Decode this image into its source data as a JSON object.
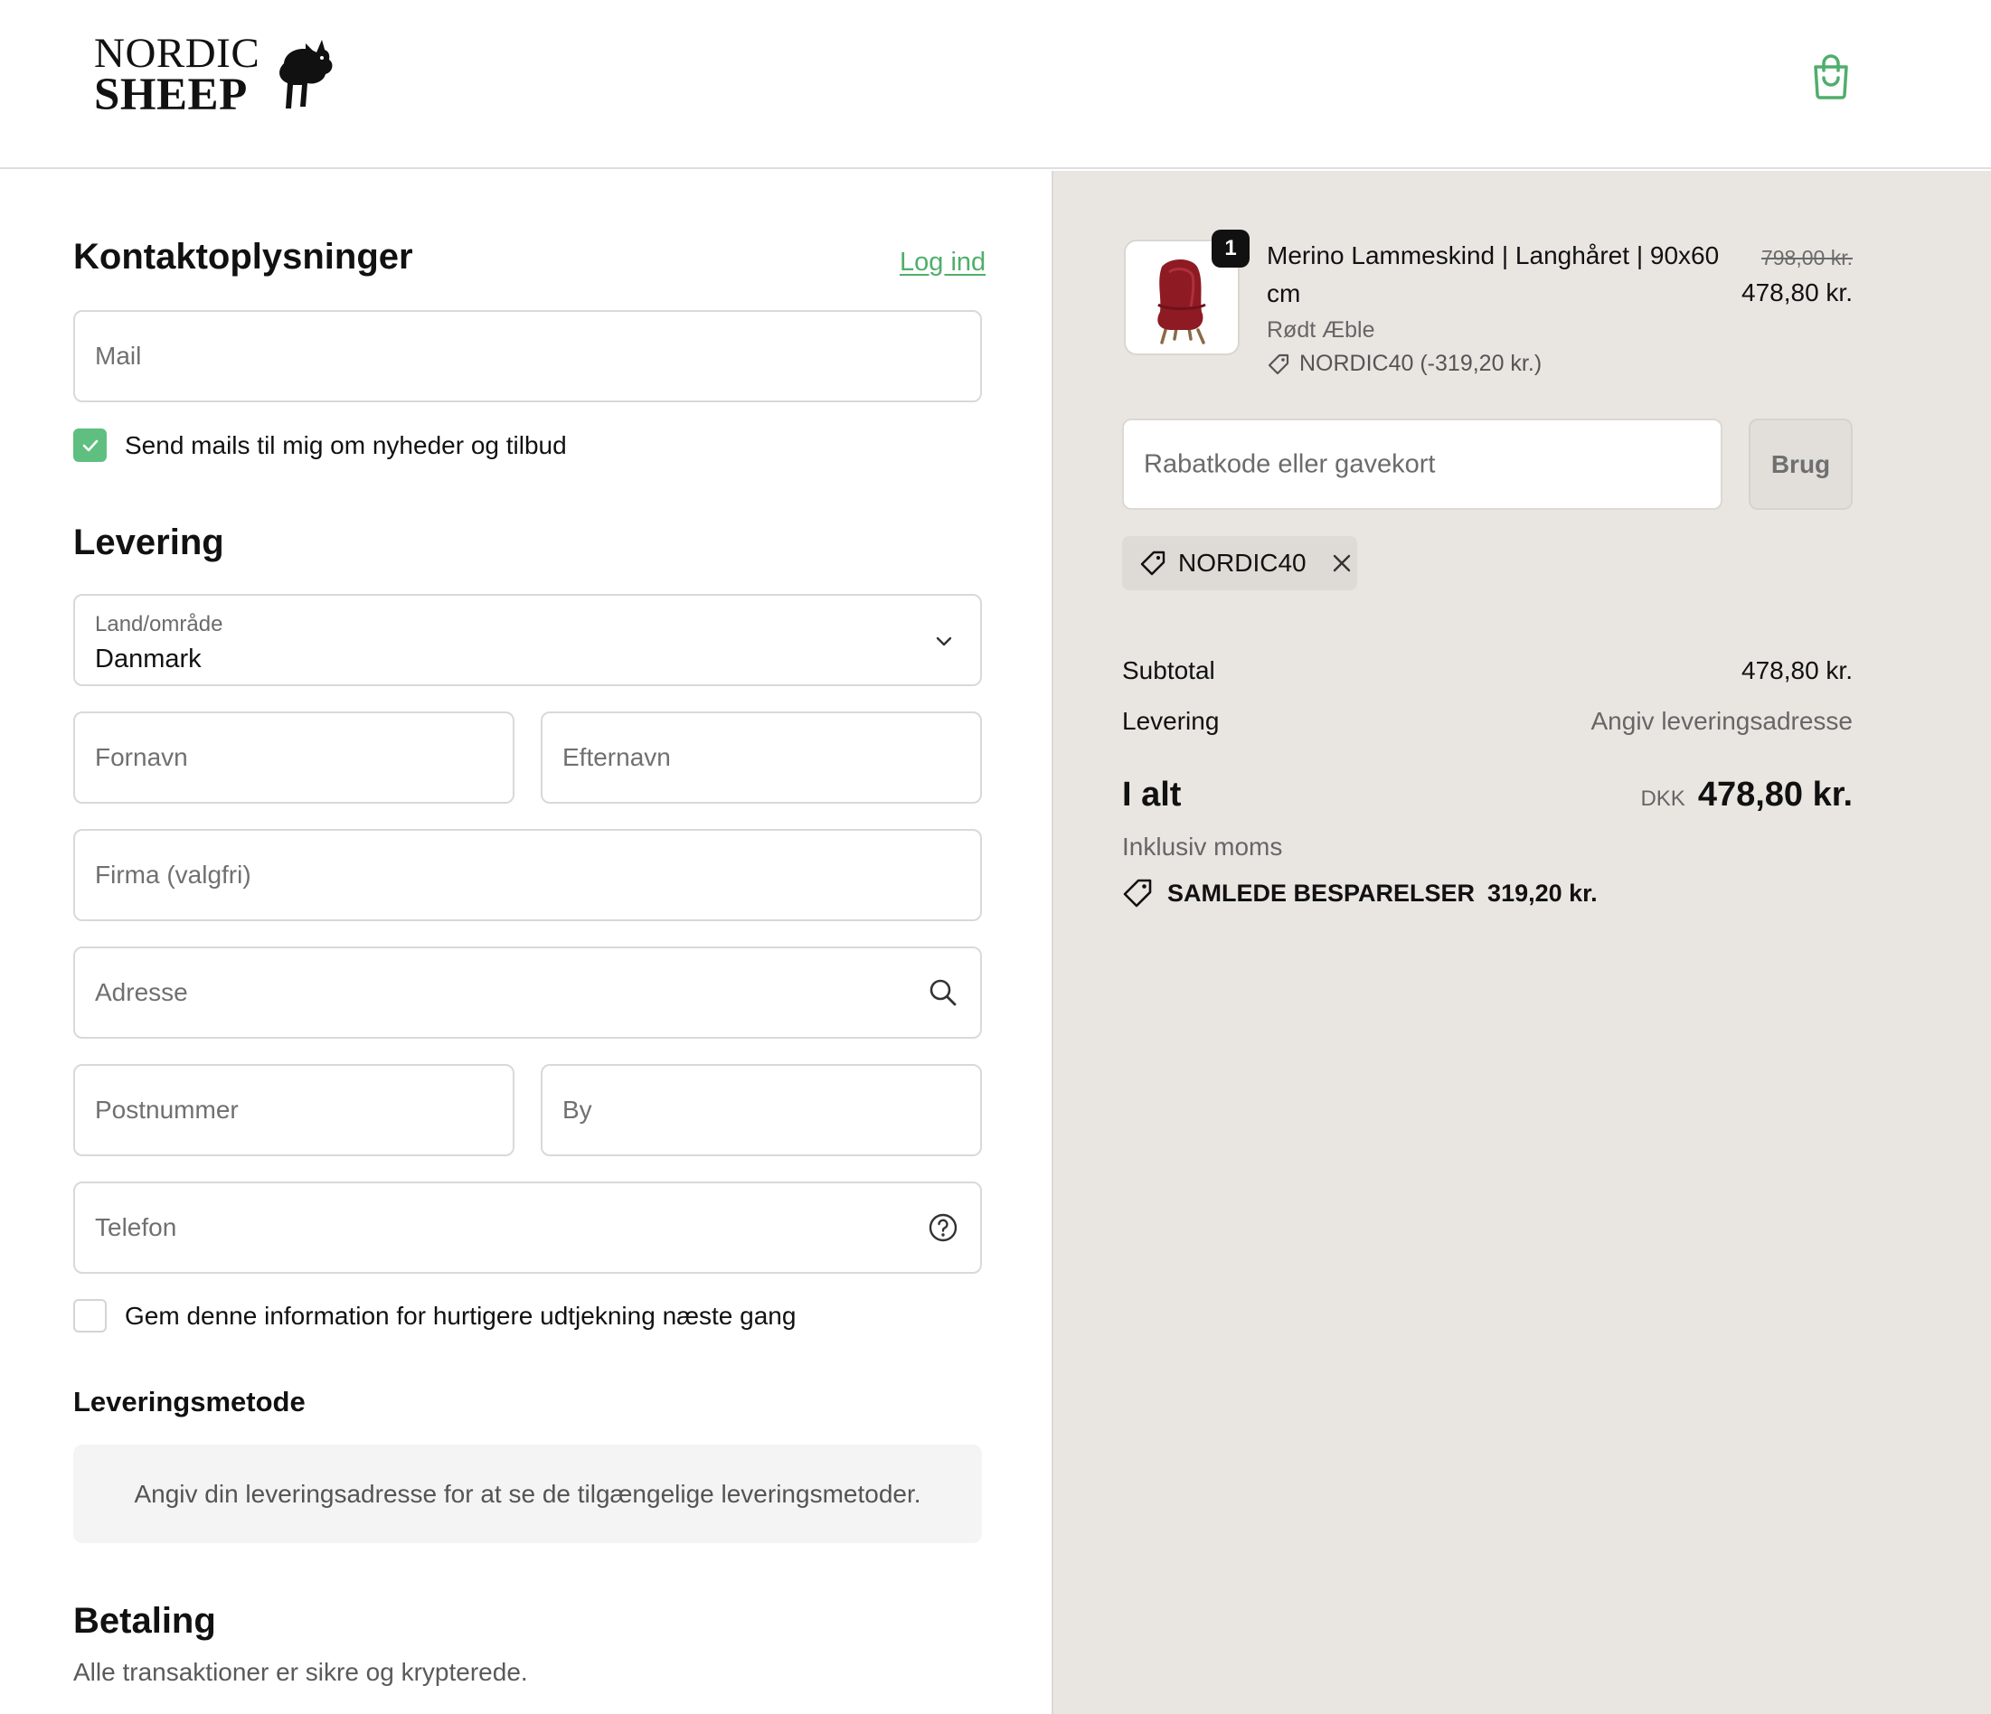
{
  "brand": {
    "line1": "NORDIC",
    "line2": "SHEEP"
  },
  "contact": {
    "title": "Kontaktoplysninger",
    "login_link": "Log ind",
    "email_placeholder": "Mail",
    "newsletter_label": "Send mails til mig om nyheder og tilbud",
    "newsletter_checked": true
  },
  "delivery": {
    "title": "Levering",
    "country_label": "Land/område",
    "country_value": "Danmark",
    "first_name_placeholder": "Fornavn",
    "last_name_placeholder": "Efternavn",
    "company_placeholder": "Firma (valgfri)",
    "address_placeholder": "Adresse",
    "postal_placeholder": "Postnummer",
    "city_placeholder": "By",
    "phone_placeholder": "Telefon",
    "save_info_label": "Gem denne information for hurtigere udtjekning næste gang",
    "save_info_checked": false
  },
  "shipping_method": {
    "title": "Leveringsmetode",
    "info": "Angiv din leveringsadresse for at se de tilgængelige leveringsmetoder."
  },
  "payment": {
    "title": "Betaling",
    "subtitle": "Alle transaktioner er sikre og krypterede."
  },
  "summary": {
    "item": {
      "quantity": "1",
      "title": "Merino Lammeskind | Langhåret | 90x60 cm",
      "variant": "Rødt Æble",
      "discount": "NORDIC40 (-319,20 kr.)",
      "old_price": "798,00 kr.",
      "price": "478,80 kr."
    },
    "discount_placeholder": "Rabatkode eller gavekort",
    "apply_label": "Brug",
    "applied_code": "NORDIC40",
    "subtotal_label": "Subtotal",
    "subtotal_value": "478,80 kr.",
    "shipping_label": "Levering",
    "shipping_value": "Angiv leveringsadresse",
    "total_label": "I alt",
    "currency": "DKK",
    "total_value": "478,80 kr.",
    "vat_note": "Inklusiv moms",
    "savings_label": "SAMLEDE BESPARELSER",
    "savings_value": "319,20 kr."
  },
  "colors": {
    "accent": "#5fbf80",
    "summary_bg": "#e9e6e2",
    "link": "#4fae6b"
  },
  "icons": [
    "sheep-logo",
    "shopping-bag-icon",
    "checkmark-icon",
    "chevron-down-icon",
    "search-icon",
    "help-circle-icon",
    "tag-icon",
    "close-icon"
  ]
}
